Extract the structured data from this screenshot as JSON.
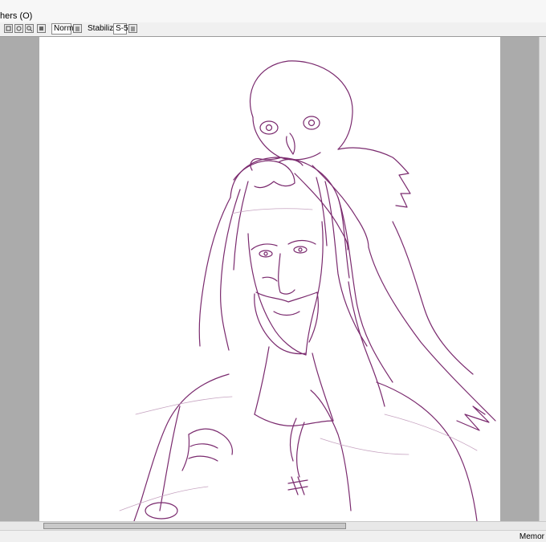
{
  "menu": {
    "others_label": "hers (O)"
  },
  "toolbar": {
    "blend_mode": "Normal",
    "stabilizer_label": "Stabilizer",
    "stabilizer_value": "S-5"
  },
  "status": {
    "memory_label": "Memor"
  },
  "colors": {
    "canvas_bg": "#ffffff",
    "workspace_bg": "#ababab",
    "stroke": "#7a2a6e",
    "stroke_light": "#c6a3c0"
  },
  "horizontal_scroll_fraction": 0.56
}
